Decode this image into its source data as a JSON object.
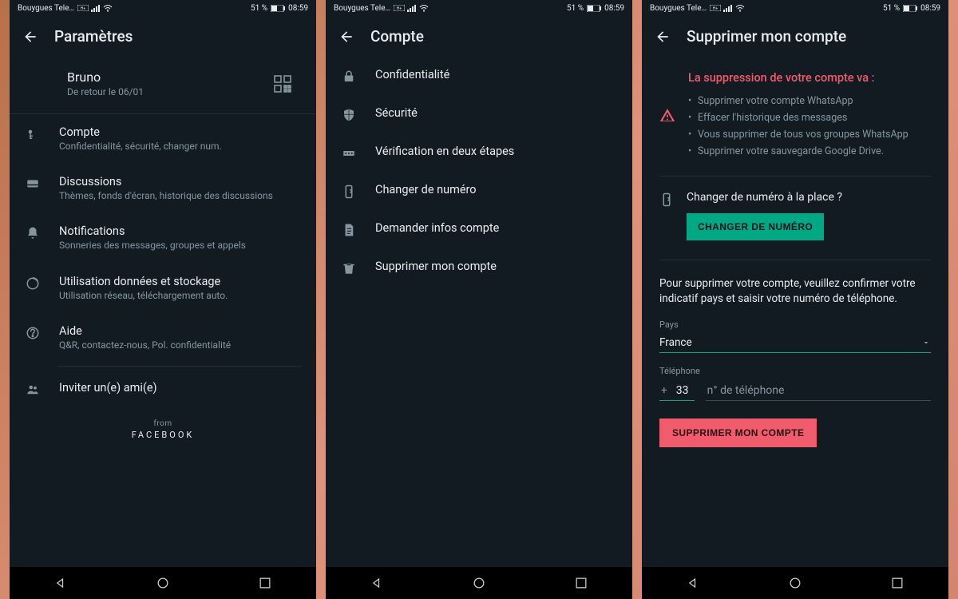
{
  "status": {
    "carrier": "Bouygues Tele…",
    "battery": "51 %",
    "time": "08:59"
  },
  "screen1": {
    "title": "Paramètres",
    "profile": {
      "name": "Bruno",
      "status": "De retour le 06/01"
    },
    "items": [
      {
        "title": "Compte",
        "sub": "Confidentialité, sécurité, changer num."
      },
      {
        "title": "Discussions",
        "sub": "Thèmes, fonds d'écran, historique des discussions"
      },
      {
        "title": "Notifications",
        "sub": "Sonneries des messages, groupes et appels"
      },
      {
        "title": "Utilisation données et stockage",
        "sub": "Utilisation réseau, téléchargement auto."
      },
      {
        "title": "Aide",
        "sub": "Q&R, contactez-nous, Pol. confidentialité"
      },
      {
        "title": "Inviter un(e) ami(e)",
        "sub": ""
      }
    ],
    "from": "from",
    "facebook": "FACEBOOK"
  },
  "screen2": {
    "title": "Compte",
    "items": [
      "Confidentialité",
      "Sécurité",
      "Vérification en deux étapes",
      "Changer de numéro",
      "Demander infos compte",
      "Supprimer mon compte"
    ]
  },
  "screen3": {
    "title": "Supprimer mon compte",
    "warn_title": "La suppression de votre compte va :",
    "bullets": [
      "Supprimer votre compte WhatsApp",
      "Effacer l'historique des messages",
      "Vous supprimer de tous vos groupes WhatsApp",
      "Supprimer votre sauvegarde Google Drive."
    ],
    "change_label": "Changer de numéro à la place ?",
    "change_btn": "CHANGER DE NUMÉRO",
    "confirm_text": "Pour supprimer votre compte, veuillez confirmer votre indicatif pays et saisir votre numéro de téléphone.",
    "country_label": "Pays",
    "country_value": "France",
    "phone_label": "Téléphone",
    "plus": "+",
    "dial_code": "33",
    "phone_placeholder": "n° de téléphone",
    "delete_btn": "SUPPRIMER MON COMPTE"
  }
}
